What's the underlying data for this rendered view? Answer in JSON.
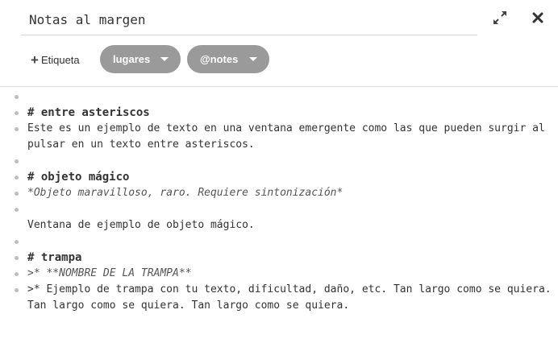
{
  "header": {
    "title_value": "Notas al margen",
    "expand_icon": "expand-icon",
    "close_icon": "close-icon"
  },
  "tags": {
    "add_label": "Etiqueta",
    "pills": [
      {
        "label": "lugares"
      },
      {
        "label": "@notes"
      }
    ]
  },
  "editor": {
    "lines": [
      {
        "text": ""
      },
      {
        "text": "# entre asteriscos"
      },
      {
        "text": "Este es un ejemplo de texto en una ventana emergente como las que pueden surgir al pulsar en un texto entre asteriscos."
      },
      {
        "text": ""
      },
      {
        "text": "# objeto mágico"
      },
      {
        "text": "*Objeto maravilloso, raro. Requiere sintonización*"
      },
      {
        "text": ""
      },
      {
        "text": "Ventana de ejemplo de objeto mágico."
      },
      {
        "text": ""
      },
      {
        "text": "# trampa"
      },
      {
        "text": ">* **NOMBRE DE LA TRAMPA**"
      },
      {
        "text": ">* Ejemplo de trampa con tu texto, dificultad, daño, etc. Tan largo como se quiera. Tan largo como se quiera. Tan largo como se quiera."
      }
    ]
  },
  "colors": {
    "pill_bg": "#9a9a9a",
    "bullet": "#bdbdbd",
    "divider": "#dcdcdc"
  }
}
